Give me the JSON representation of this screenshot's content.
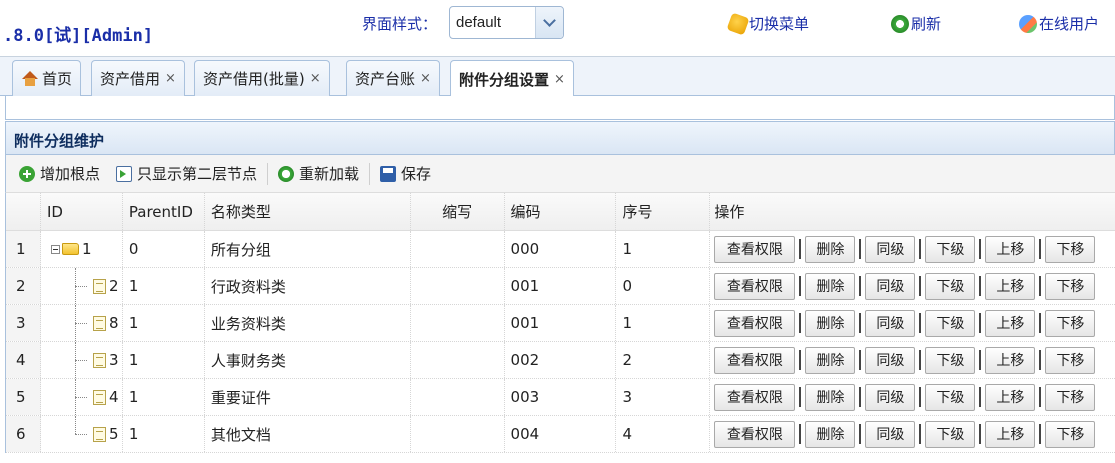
{
  "header": {
    "brand": ".8.0[试][Admin]",
    "style_label": "界面样式：",
    "style_value": "default",
    "links": [
      "切换菜单",
      "刷新",
      "在线用户"
    ]
  },
  "tabs": [
    {
      "label": "首页",
      "closable": false
    },
    {
      "label": "资产借用",
      "closable": true
    },
    {
      "label": "资产借用(批量)",
      "closable": true
    },
    {
      "label": "资产台账",
      "closable": true
    },
    {
      "label": "附件分组设置",
      "closable": true,
      "active": true
    }
  ],
  "close_glyph": "×",
  "panel": {
    "title": "附件分组维护",
    "toolbar": [
      "增加根点",
      "只显示第二层节点",
      "重新加载",
      "保存"
    ]
  },
  "grid": {
    "columns": [
      "",
      "ID",
      "ParentID",
      "名称类型",
      "缩写",
      "编码",
      "序号",
      "操作"
    ],
    "rows": [
      {
        "rn": "1",
        "id": "1",
        "pid": "0",
        "name": "所有分组",
        "abbr": "",
        "code": "000",
        "ord": "1",
        "root": true
      },
      {
        "rn": "2",
        "id": "2",
        "pid": "1",
        "name": "行政资料类",
        "abbr": "",
        "code": "001",
        "ord": "0"
      },
      {
        "rn": "3",
        "id": "8",
        "pid": "1",
        "name": "业务资料类",
        "abbr": "",
        "code": "001",
        "ord": "1"
      },
      {
        "rn": "4",
        "id": "3",
        "pid": "1",
        "name": "人事财务类",
        "abbr": "",
        "code": "002",
        "ord": "2"
      },
      {
        "rn": "5",
        "id": "4",
        "pid": "1",
        "name": "重要证件",
        "abbr": "",
        "code": "003",
        "ord": "3"
      },
      {
        "rn": "6",
        "id": "5",
        "pid": "1",
        "name": "其他文档",
        "abbr": "",
        "code": "004",
        "ord": "4",
        "last": true
      }
    ],
    "actions": [
      "查看权限",
      "删除",
      "同级",
      "下级",
      "上移",
      "下移"
    ]
  }
}
